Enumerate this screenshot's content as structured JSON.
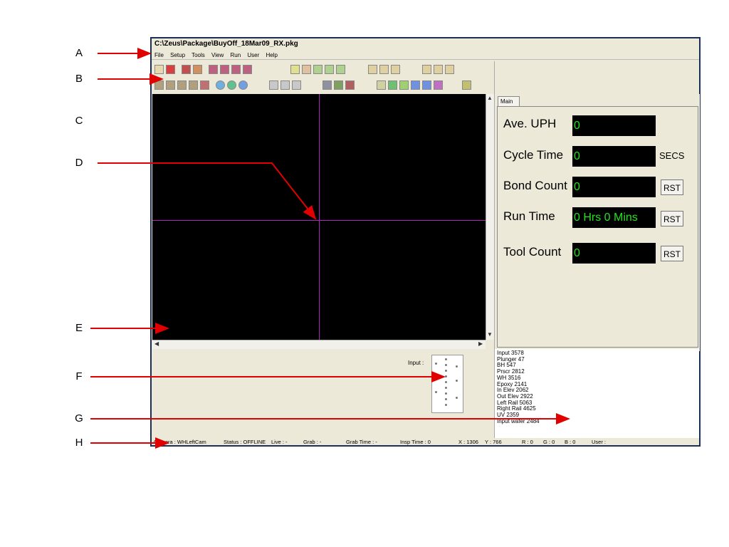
{
  "callouts": [
    "A",
    "B",
    "C",
    "D",
    "E",
    "F",
    "G",
    "H"
  ],
  "window": {
    "title": "C:\\Zeus\\Package\\BuyOff_18Mar09_RX.pkg"
  },
  "menu": [
    "File",
    "Setup",
    "Tools",
    "View",
    "Run",
    "User",
    "Help"
  ],
  "tabs": [
    "Main"
  ],
  "stats": {
    "uph_label": "Ave. UPH",
    "uph_value": "0",
    "cycle_label": "Cycle Time",
    "cycle_value": "0",
    "cycle_unit": "SECS",
    "bond_label": "Bond Count",
    "bond_value": "0",
    "run_label": "Run Time",
    "run_value": "0 Hrs 0 Mins",
    "tool_label": "Tool Count",
    "tool_value": "0",
    "rst_label": "RST"
  },
  "input_label": "Input :",
  "log": [
    "Input 3578",
    "Plunger 47",
    "BH 547",
    "Prscr 2812",
    "WH 3516",
    "Epoxy 2141",
    "In Elev 2062",
    "Out Elev 2922",
    "Left Rail 5063",
    "Right Rail 4625",
    "UV 2359",
    "Input wafer 2484"
  ],
  "status": {
    "camera": "Camera : WHLeftCam",
    "state": "Status : OFFLINE",
    "live": "Live : -",
    "grab": "Grab : -",
    "grab_time": "Grab Time : -",
    "insp_time": "Insp Time : 0",
    "x": "X : 1306",
    "y": "Y : 766",
    "r": "R : 0",
    "g": "G : 0",
    "b": "B : 0",
    "user": "User :"
  },
  "colors": {
    "stat_text": "#22e31c",
    "crosshair": "#b020c0",
    "arrow": "#e00000",
    "frame": "#1c2f59"
  }
}
